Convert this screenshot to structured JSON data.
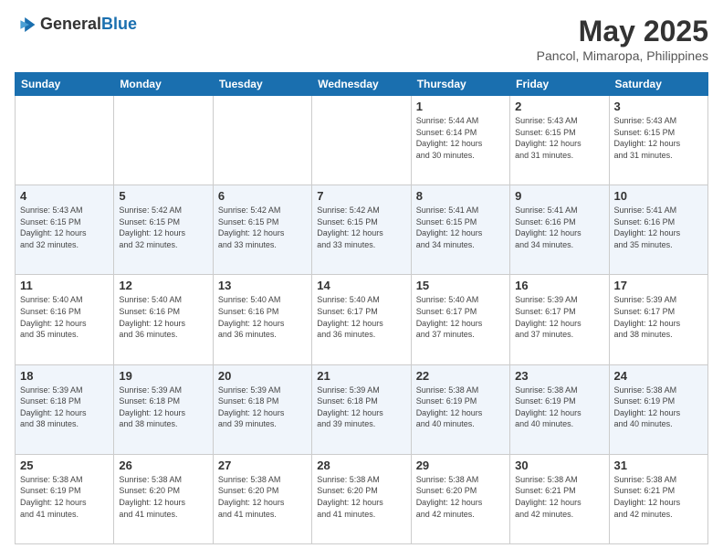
{
  "header": {
    "logo_general": "General",
    "logo_blue": "Blue",
    "title": "May 2025",
    "location": "Pancol, Mimaropa, Philippines"
  },
  "days_of_week": [
    "Sunday",
    "Monday",
    "Tuesday",
    "Wednesday",
    "Thursday",
    "Friday",
    "Saturday"
  ],
  "weeks": [
    [
      {
        "day": "",
        "info": ""
      },
      {
        "day": "",
        "info": ""
      },
      {
        "day": "",
        "info": ""
      },
      {
        "day": "",
        "info": ""
      },
      {
        "day": "1",
        "info": "Sunrise: 5:44 AM\nSunset: 6:14 PM\nDaylight: 12 hours\nand 30 minutes."
      },
      {
        "day": "2",
        "info": "Sunrise: 5:43 AM\nSunset: 6:15 PM\nDaylight: 12 hours\nand 31 minutes."
      },
      {
        "day": "3",
        "info": "Sunrise: 5:43 AM\nSunset: 6:15 PM\nDaylight: 12 hours\nand 31 minutes."
      }
    ],
    [
      {
        "day": "4",
        "info": "Sunrise: 5:43 AM\nSunset: 6:15 PM\nDaylight: 12 hours\nand 32 minutes."
      },
      {
        "day": "5",
        "info": "Sunrise: 5:42 AM\nSunset: 6:15 PM\nDaylight: 12 hours\nand 32 minutes."
      },
      {
        "day": "6",
        "info": "Sunrise: 5:42 AM\nSunset: 6:15 PM\nDaylight: 12 hours\nand 33 minutes."
      },
      {
        "day": "7",
        "info": "Sunrise: 5:42 AM\nSunset: 6:15 PM\nDaylight: 12 hours\nand 33 minutes."
      },
      {
        "day": "8",
        "info": "Sunrise: 5:41 AM\nSunset: 6:15 PM\nDaylight: 12 hours\nand 34 minutes."
      },
      {
        "day": "9",
        "info": "Sunrise: 5:41 AM\nSunset: 6:16 PM\nDaylight: 12 hours\nand 34 minutes."
      },
      {
        "day": "10",
        "info": "Sunrise: 5:41 AM\nSunset: 6:16 PM\nDaylight: 12 hours\nand 35 minutes."
      }
    ],
    [
      {
        "day": "11",
        "info": "Sunrise: 5:40 AM\nSunset: 6:16 PM\nDaylight: 12 hours\nand 35 minutes."
      },
      {
        "day": "12",
        "info": "Sunrise: 5:40 AM\nSunset: 6:16 PM\nDaylight: 12 hours\nand 36 minutes."
      },
      {
        "day": "13",
        "info": "Sunrise: 5:40 AM\nSunset: 6:16 PM\nDaylight: 12 hours\nand 36 minutes."
      },
      {
        "day": "14",
        "info": "Sunrise: 5:40 AM\nSunset: 6:17 PM\nDaylight: 12 hours\nand 36 minutes."
      },
      {
        "day": "15",
        "info": "Sunrise: 5:40 AM\nSunset: 6:17 PM\nDaylight: 12 hours\nand 37 minutes."
      },
      {
        "day": "16",
        "info": "Sunrise: 5:39 AM\nSunset: 6:17 PM\nDaylight: 12 hours\nand 37 minutes."
      },
      {
        "day": "17",
        "info": "Sunrise: 5:39 AM\nSunset: 6:17 PM\nDaylight: 12 hours\nand 38 minutes."
      }
    ],
    [
      {
        "day": "18",
        "info": "Sunrise: 5:39 AM\nSunset: 6:18 PM\nDaylight: 12 hours\nand 38 minutes."
      },
      {
        "day": "19",
        "info": "Sunrise: 5:39 AM\nSunset: 6:18 PM\nDaylight: 12 hours\nand 38 minutes."
      },
      {
        "day": "20",
        "info": "Sunrise: 5:39 AM\nSunset: 6:18 PM\nDaylight: 12 hours\nand 39 minutes."
      },
      {
        "day": "21",
        "info": "Sunrise: 5:39 AM\nSunset: 6:18 PM\nDaylight: 12 hours\nand 39 minutes."
      },
      {
        "day": "22",
        "info": "Sunrise: 5:38 AM\nSunset: 6:19 PM\nDaylight: 12 hours\nand 40 minutes."
      },
      {
        "day": "23",
        "info": "Sunrise: 5:38 AM\nSunset: 6:19 PM\nDaylight: 12 hours\nand 40 minutes."
      },
      {
        "day": "24",
        "info": "Sunrise: 5:38 AM\nSunset: 6:19 PM\nDaylight: 12 hours\nand 40 minutes."
      }
    ],
    [
      {
        "day": "25",
        "info": "Sunrise: 5:38 AM\nSunset: 6:19 PM\nDaylight: 12 hours\nand 41 minutes."
      },
      {
        "day": "26",
        "info": "Sunrise: 5:38 AM\nSunset: 6:20 PM\nDaylight: 12 hours\nand 41 minutes."
      },
      {
        "day": "27",
        "info": "Sunrise: 5:38 AM\nSunset: 6:20 PM\nDaylight: 12 hours\nand 41 minutes."
      },
      {
        "day": "28",
        "info": "Sunrise: 5:38 AM\nSunset: 6:20 PM\nDaylight: 12 hours\nand 41 minutes."
      },
      {
        "day": "29",
        "info": "Sunrise: 5:38 AM\nSunset: 6:20 PM\nDaylight: 12 hours\nand 42 minutes."
      },
      {
        "day": "30",
        "info": "Sunrise: 5:38 AM\nSunset: 6:21 PM\nDaylight: 12 hours\nand 42 minutes."
      },
      {
        "day": "31",
        "info": "Sunrise: 5:38 AM\nSunset: 6:21 PM\nDaylight: 12 hours\nand 42 minutes."
      }
    ]
  ]
}
